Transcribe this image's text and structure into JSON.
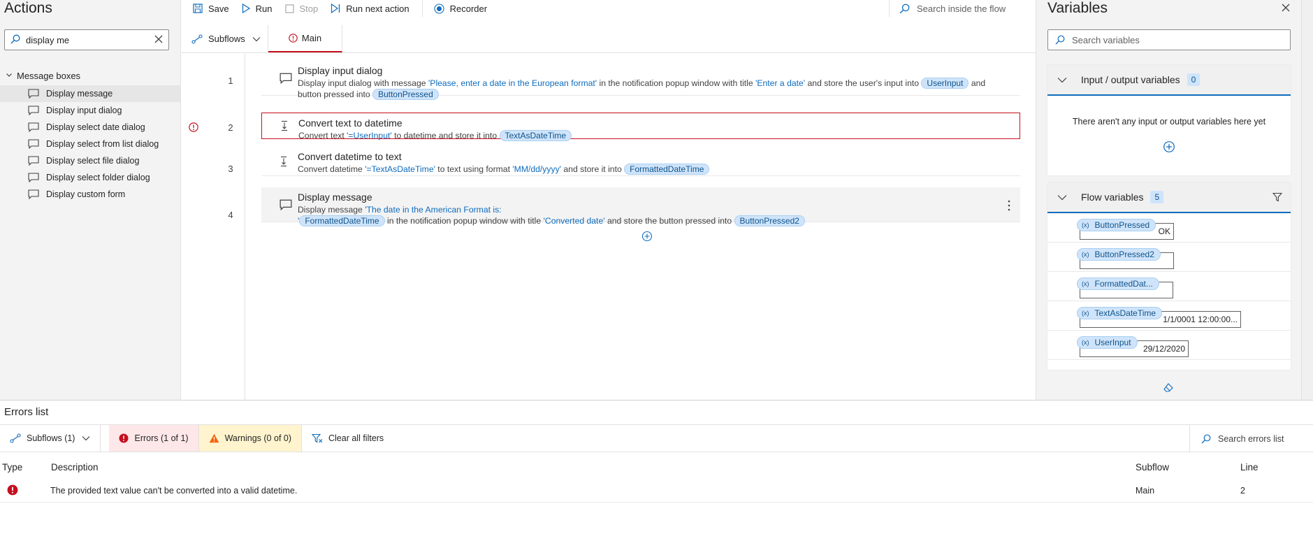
{
  "actions": {
    "title": "Actions",
    "search_value": "display me",
    "group": "Message boxes",
    "items": [
      "Display message",
      "Display input dialog",
      "Display select date dialog",
      "Display select from list dialog",
      "Display select file dialog",
      "Display select folder dialog",
      "Display custom form"
    ]
  },
  "toolbar": {
    "save": "Save",
    "run": "Run",
    "stop": "Stop",
    "run_next": "Run next action",
    "recorder": "Recorder",
    "search_placeholder": "Search inside the flow"
  },
  "tabs": {
    "subflows": "Subflows",
    "main": "Main"
  },
  "steps": [
    {
      "line": "1",
      "title": "Display input dialog",
      "desc": {
        "p1": "Display input dialog with message ",
        "lit1": "'Please, enter a date in the European format'",
        "p2": " in the notification popup window with title ",
        "lit2": "'Enter a date'",
        "p3": " and store the user's input into ",
        "var1": "UserInput",
        "p4": " and button pressed into ",
        "var2": "ButtonPressed"
      }
    },
    {
      "line": "2",
      "title": "Convert text to datetime",
      "desc": {
        "p1": "Convert text ",
        "lit1": "'=UserInput'",
        "p2": " to datetime and store it into ",
        "var1": "TextAsDateTime"
      }
    },
    {
      "line": "3",
      "title": "Convert datetime to text",
      "desc": {
        "p1": "Convert datetime ",
        "lit1": "'=TextAsDateTime'",
        "p2": " to text using format ",
        "lit2": "'MM/dd/yyyy'",
        "p3": " and store it into ",
        "var1": "FormattedDateTime"
      }
    },
    {
      "line": "4",
      "title": "Display message",
      "desc": {
        "p1": "Display message ",
        "lit1": "'The date in the American Format is:",
        "lit2": "'",
        "var1": "FormattedDateTime",
        "p2": " in the notification popup window with title ",
        "lit3": "'Converted date'",
        "p3": " and store the button pressed into ",
        "var2": "ButtonPressed2"
      }
    }
  ],
  "variables": {
    "title": "Variables",
    "search_placeholder": "Search variables",
    "io": {
      "label": "Input / output variables",
      "count": "0",
      "empty": "There aren't any input or output variables here yet"
    },
    "flow": {
      "label": "Flow variables",
      "count": "5",
      "items": [
        {
          "name": "ButtonPressed",
          "value": "OK"
        },
        {
          "name": "ButtonPressed2",
          "value": ""
        },
        {
          "name": "FormattedDat...",
          "value": ""
        },
        {
          "name": "TextAsDateTime",
          "value": "1/1/0001 12:00:00..."
        },
        {
          "name": "UserInput",
          "value": "29/12/2020"
        }
      ]
    }
  },
  "errors": {
    "title": "Errors list",
    "subflows_filter": "Subflows (1)",
    "errors_filter": "Errors (1 of 1)",
    "warnings_filter": "Warnings (0 of 0)",
    "clear_filters": "Clear all filters",
    "search_placeholder": "Search errors list",
    "columns": {
      "type": "Type",
      "description": "Description",
      "subflow": "Subflow",
      "line": "Line"
    },
    "rows": [
      {
        "description": "The provided text value can't be converted into a valid datetime.",
        "subflow": "Main",
        "line": "2"
      }
    ]
  },
  "colors": {
    "accent": "#0f6cbd",
    "error": "#c50f1f",
    "warning": "#f7630c",
    "variable_chip": "#cfe4fa"
  }
}
